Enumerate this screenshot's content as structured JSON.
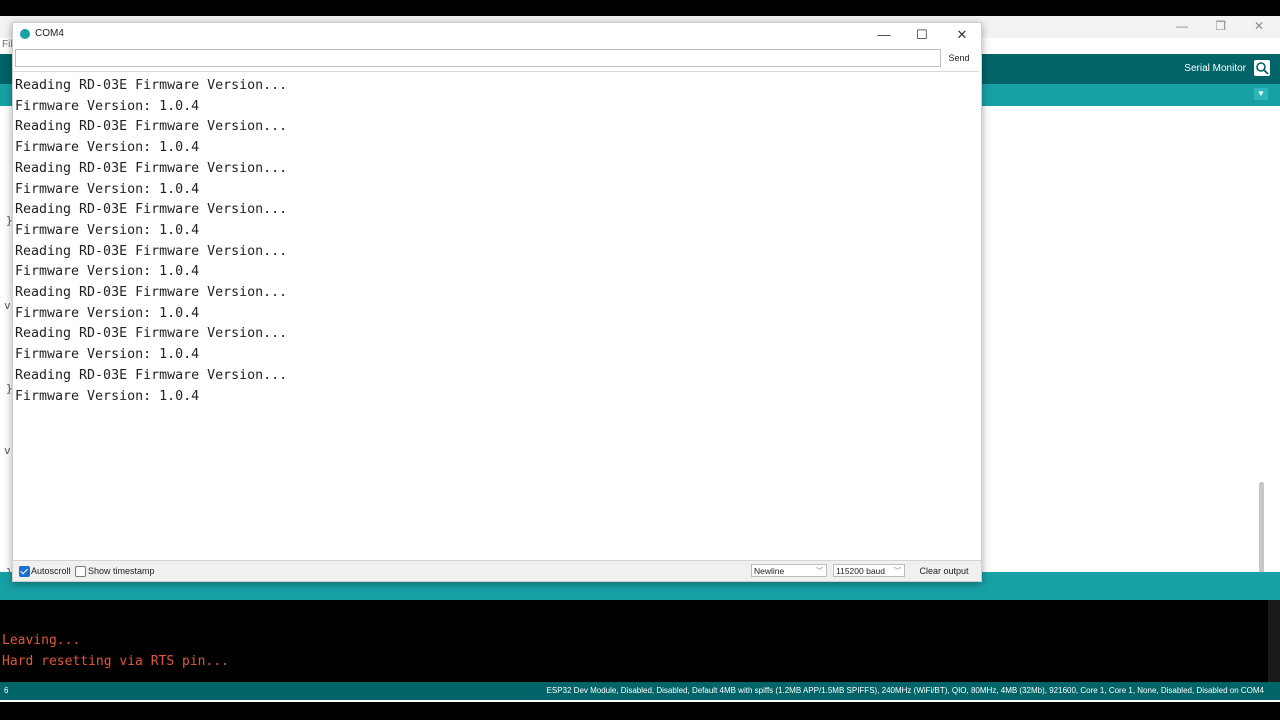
{
  "ide": {
    "menu_hint": "Fil",
    "toolbar": {
      "serial_monitor_label": "Serial Monitor"
    },
    "output": {
      "lines": [
        "Leaving...",
        "Hard resetting via RTS pin..."
      ]
    },
    "statusbar": {
      "line_number": "6",
      "board": "ESP32 Dev Module, Disabled, Disabled, Default 4MB with spiffs (1.2MB APP/1.5MB SPIFFS), 240MHz (WiFi/BT), QIO, 80MHz, 4MB (32Mb), 921600, Core 1, Core 1, None, Disabled, Disabled on COM4"
    },
    "gutter": [
      "}",
      "v",
      "}",
      "}",
      "v"
    ]
  },
  "serial_window": {
    "title": "COM4",
    "controls": {
      "minimize": "—",
      "maximize": "☐",
      "close": "✕"
    },
    "input": {
      "value": "",
      "placeholder": ""
    },
    "send_label": "Send",
    "output_lines": [
      "Reading RD-03E Firmware Version...",
      "Firmware Version: 1.0.4",
      "Reading RD-03E Firmware Version...",
      "Firmware Version: 1.0.4",
      "Reading RD-03E Firmware Version...",
      "Firmware Version: 1.0.4",
      "Reading RD-03E Firmware Version...",
      "Firmware Version: 1.0.4",
      "Reading RD-03E Firmware Version...",
      "Firmware Version: 1.0.4",
      "Reading RD-03E Firmware Version...",
      "Firmware Version: 1.0.4",
      "Reading RD-03E Firmware Version...",
      "Firmware Version: 1.0.4",
      "Reading RD-03E Firmware Version...",
      "Firmware Version: 1.0.4"
    ],
    "bottom": {
      "autoscroll_label": "Autoscroll",
      "autoscroll_checked": true,
      "timestamp_label": "Show timestamp",
      "timestamp_checked": false,
      "line_ending": "Newline",
      "baud": "115200 baud",
      "clear_label": "Clear output"
    }
  },
  "colors": {
    "ide_teal_dark": "#006468",
    "ide_teal": "#17a1a5",
    "output_text": "#e0593a",
    "checkbox_accent": "#1a6fd1"
  }
}
